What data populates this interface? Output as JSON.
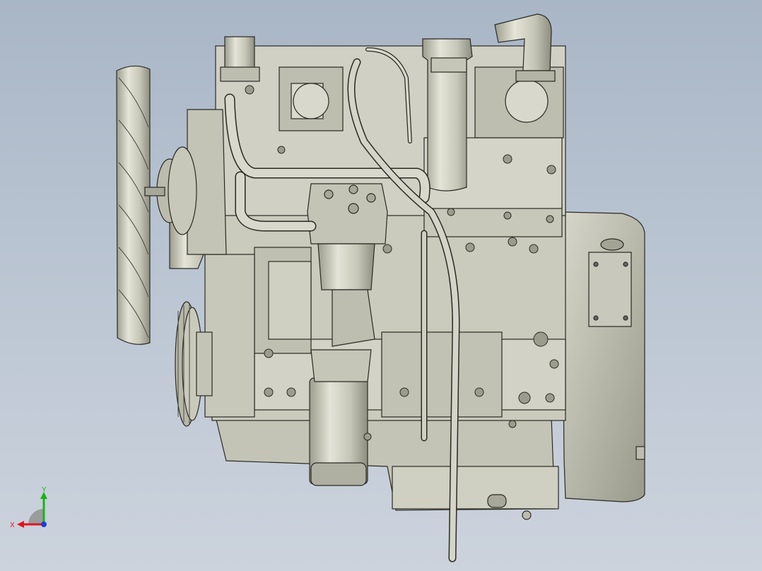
{
  "scene": {
    "model": "engine-assembly",
    "view": "front"
  },
  "triad": {
    "x_label": "X",
    "y_label": "Y",
    "x_color": "#e0141e",
    "y_color": "#19b419",
    "z_color": "#1a3fd6"
  },
  "colors": {
    "background_top": "#a9b6c6",
    "background_bottom": "#ccd3dd",
    "metal_light": "#dcdcd0",
    "metal_mid": "#b9b9aa",
    "metal_dark": "#8a8a7c",
    "outline": "#2a2a24"
  }
}
